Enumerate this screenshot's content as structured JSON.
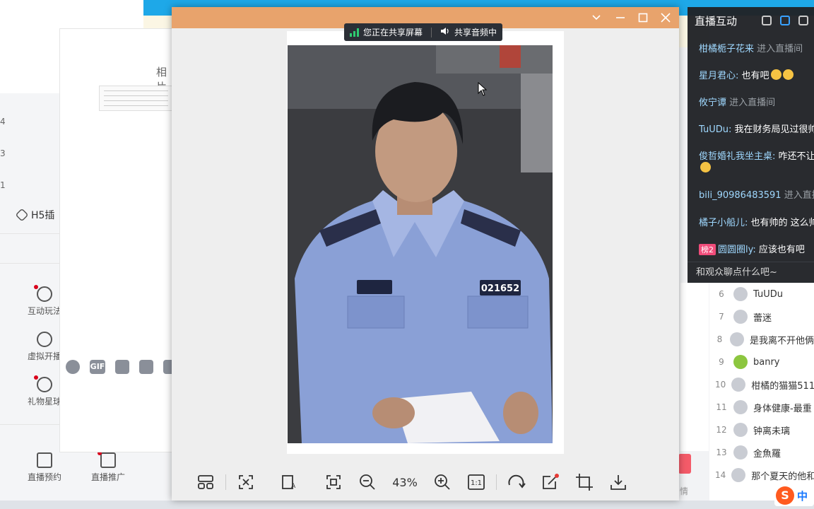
{
  "background": {
    "left_numbers": [
      "4",
      "3",
      "1"
    ],
    "h5_label": "H5插",
    "xiang_label": "相片",
    "tools": [
      "互动玩法",
      "虚拟开播",
      "礼物星球"
    ],
    "bottom_tools": [
      "直播预约",
      "直播推广"
    ],
    "desc_suffix": "情"
  },
  "viewer": {
    "share_banner": {
      "screen": "您正在共享屏幕",
      "audio": "共享音频中"
    },
    "badge_number": "021652",
    "zoom": "43%",
    "toolbar_icons": [
      "layout-icon",
      "fit-icon",
      "ocr-icon",
      "fullscreen-icon",
      "zoom-out-icon",
      "zoom-in-icon",
      "actual-size-icon",
      "rotate-icon",
      "edit-icon",
      "crop-icon",
      "download-icon"
    ],
    "actual_size_label": "1:1",
    "accent": "#e8a36c"
  },
  "live": {
    "title": "直播互动",
    "input_placeholder": "和观众聊点什么吧~",
    "chat": [
      {
        "user": "柑橘栀子花来",
        "sys": " 进入直播间",
        "text": ""
      },
      {
        "user": "星月君心: ",
        "sys": "",
        "text": "也有吧"
      },
      {
        "user": "攸宁谭",
        "sys": " 进入直播间",
        "text": ""
      },
      {
        "user": "TuUDu: ",
        "sys": "",
        "text": "我在财务局见过很帅"
      },
      {
        "user": "俊哲婚礼我坐主桌: ",
        "sys": "",
        "text": "咋还不让"
      },
      {
        "user": "bili_90986483591",
        "sys": " 进入直播",
        "text": ""
      },
      {
        "user": "橘子小船儿: ",
        "sys": "",
        "text": "也有帅的 这么帅"
      },
      {
        "badge": "榜2",
        "user": "圆圆圈ly: ",
        "sys": "",
        "text": "应该也有吧"
      }
    ]
  },
  "rank_list": [
    {
      "rank": "6",
      "name": "TuUDu"
    },
    {
      "rank": "7",
      "name": "蕾迷"
    },
    {
      "rank": "8",
      "name": "是我离不开他俩"
    },
    {
      "rank": "9",
      "name": "banry"
    },
    {
      "rank": "10",
      "name": "柑橘的猫猫511"
    },
    {
      "rank": "11",
      "name": "身体健康-最重"
    },
    {
      "rank": "12",
      "name": "钟离未璃"
    },
    {
      "rank": "13",
      "name": "金魚羅"
    },
    {
      "rank": "14",
      "name": "那个夏天的他和"
    }
  ],
  "ime": {
    "label": "中"
  }
}
